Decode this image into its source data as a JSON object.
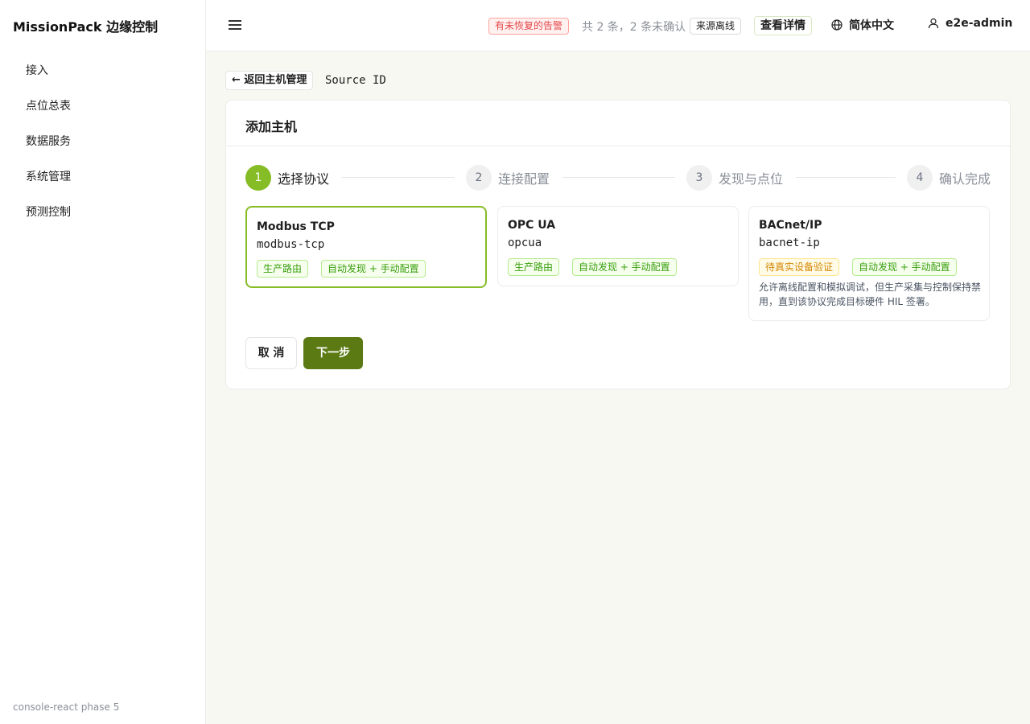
{
  "sidebar": {
    "brand": "MissionPack 边缘控制",
    "items": [
      {
        "label": "接入"
      },
      {
        "label": "点位总表"
      },
      {
        "label": "数据服务"
      },
      {
        "label": "系统管理"
      },
      {
        "label": "预测控制"
      }
    ],
    "footer": "console-react phase 5"
  },
  "header": {
    "menu_icon": "hamburger-menu-icon",
    "alarm_tag": "有未恢复的告警",
    "alarm_summary": "共 2 条，2 条未确认",
    "source_tag": "来源离线",
    "details_button": "查看详情",
    "language": "简体中文",
    "language_icon": "globe-icon",
    "username": "e2e-admin",
    "user_icon": "user-icon"
  },
  "page": {
    "back_button": "← 返回主机管理",
    "source_id_label": "Source ID"
  },
  "card": {
    "title": "添加主机",
    "steps": [
      {
        "number": "1",
        "title": "选择协议",
        "active": true
      },
      {
        "number": "2",
        "title": "连接配置",
        "active": false
      },
      {
        "number": "3",
        "title": "发现与点位",
        "active": false
      },
      {
        "number": "4",
        "title": "确认完成",
        "active": false
      }
    ],
    "protocols": [
      {
        "name": "Modbus TCP",
        "id": "modbus-tcp",
        "selected": true,
        "tags": [
          "生产路由",
          "自动发现 + 手动配置"
        ]
      },
      {
        "name": "OPC UA",
        "id": "opcua",
        "selected": false,
        "tags": [
          "生产路由",
          "自动发现 + 手动配置"
        ]
      },
      {
        "name": "BACnet/IP",
        "id": "bacnet-ip",
        "selected": false,
        "tags": [
          "待真实设备验证",
          "自动发现 + 手动配置"
        ],
        "note": "允许离线配置和模拟调试，但生产采集与控制保持禁用，直到该协议完成目标硬件 HIL 签署。"
      }
    ],
    "cancel_button": "取 消",
    "next_button": "下一步"
  },
  "colors": {
    "accent": "#86bc25",
    "primary_button": "#5b7a14",
    "alarm_red": "#e5484d",
    "tag_green": "#389e0d",
    "tag_orange": "#d48806"
  }
}
